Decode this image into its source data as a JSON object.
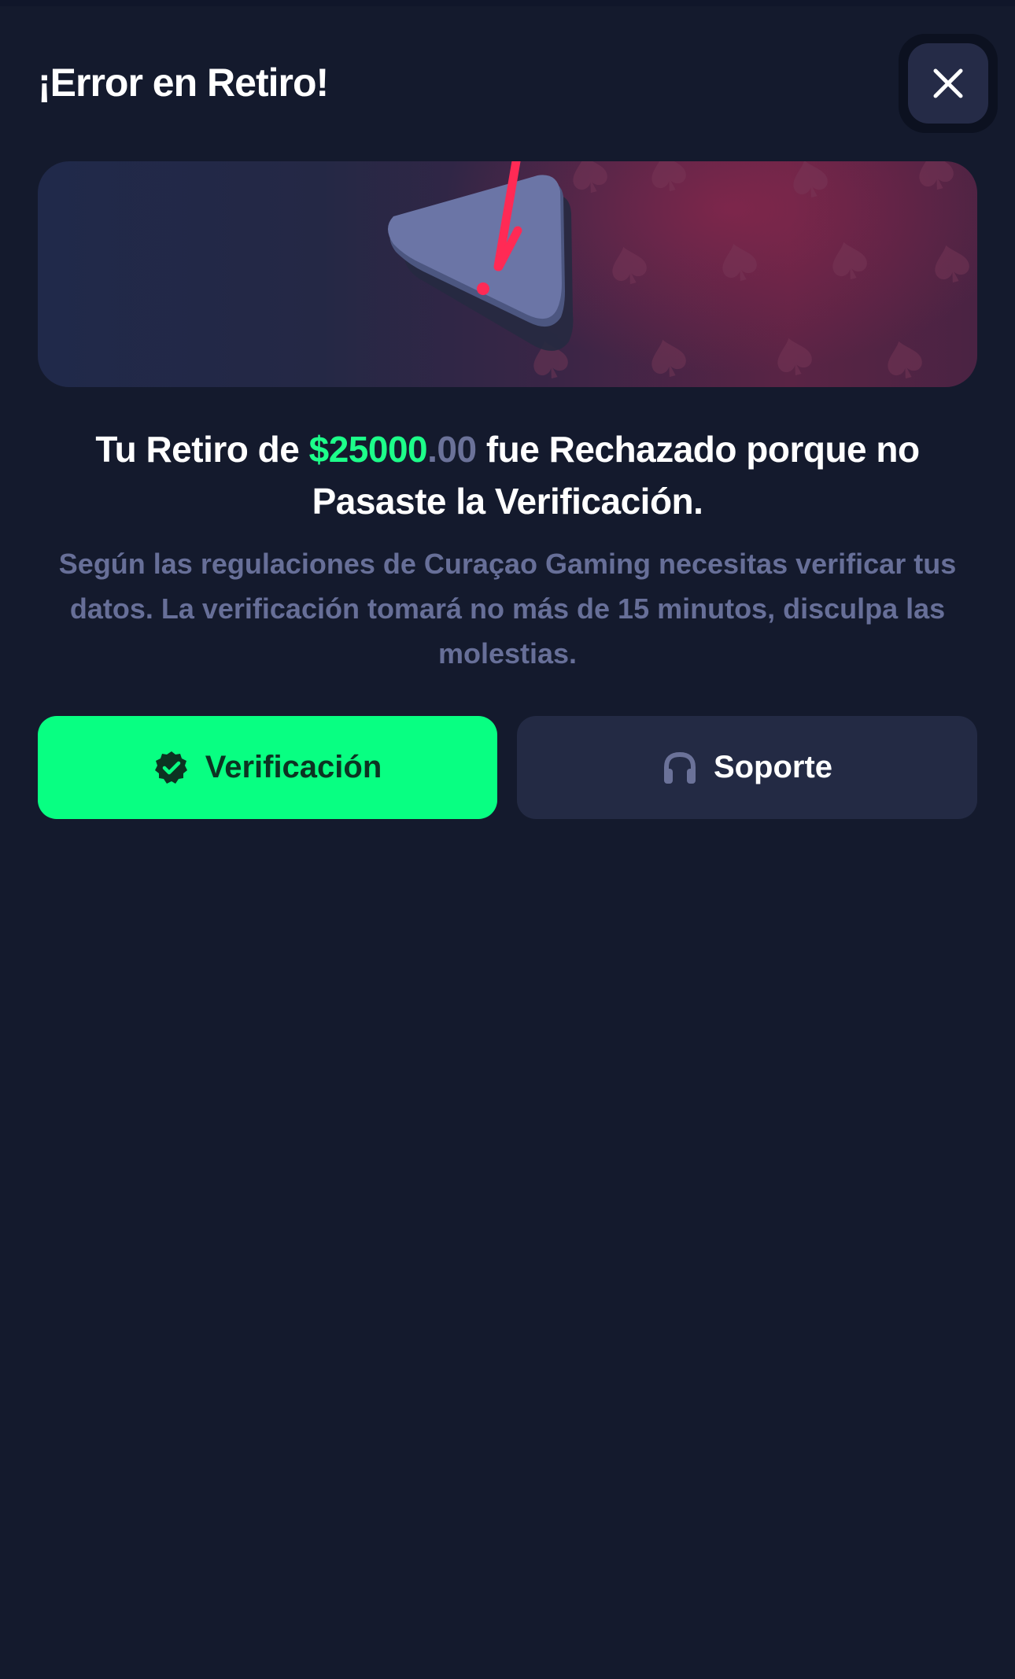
{
  "modal": {
    "title": "¡Error en Retiro!",
    "close_icon": "close-icon"
  },
  "banner": {
    "icon": "warning-triangle-icon",
    "background_icon": "spade-icon",
    "accent_color": "#ff2a55"
  },
  "message": {
    "prefix": "Tu Retiro de ",
    "amount_main": "$25000",
    "amount_cents": ".00",
    "suffix": " fue Rechazado porque no Pasaste la Verificación."
  },
  "description": "Según las regulaciones de Curaçao Gaming necesitas verificar tus datos. La verificación tomará no más de 15 minutos, disculpa las molestias.",
  "buttons": {
    "verify": {
      "label": "Verificación",
      "icon": "verified-badge-icon",
      "color": "#08ff82"
    },
    "support": {
      "label": "Soporte",
      "icon": "headset-icon",
      "color": "#232a44"
    }
  },
  "colors": {
    "background": "#141a2d",
    "amount": "#1dff8a",
    "muted_text": "#676f98"
  }
}
